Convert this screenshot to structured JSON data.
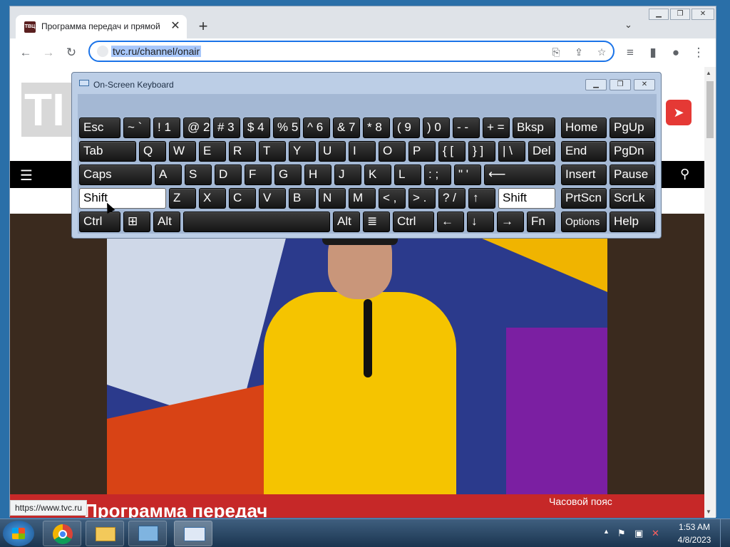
{
  "browser": {
    "tab_title": "Программа передач и прямой э",
    "tab_favicon_text": "ТВЦ",
    "new_tab": "+",
    "tab_search": "⌄",
    "url": "tvc.ru/channel/onair",
    "status_url": "https://www.tvc.ru"
  },
  "page": {
    "logo_text": "TI",
    "schedule_title": "Программа передач",
    "timezone_label": "Часовой пояс"
  },
  "osk": {
    "title": "On-Screen Keyboard",
    "keys": {
      "esc": "Esc",
      "tilde": "~ `",
      "n1": "! 1",
      "n2": "@ 2",
      "n3": "# 3",
      "n4": "$ 4",
      "n5": "% 5",
      "n6": "^ 6",
      "n7": "& 7",
      "n8": "* 8",
      "n9": "( 9",
      "n0": ") 0",
      "minus": "- -",
      "plus": "+ =",
      "bksp": "Bksp",
      "home": "Home",
      "pgup": "PgUp",
      "tab": "Tab",
      "q": "Q",
      "w": "W",
      "e": "E",
      "r": "R",
      "t": "T",
      "y": "Y",
      "u": "U",
      "i": "I",
      "o": "O",
      "p": "P",
      "lbrace": "{ [",
      "rbrace": "} ]",
      "pipe": "| \\",
      "del": "Del",
      "end": "End",
      "pgdn": "PgDn",
      "caps": "Caps",
      "a": "A",
      "s": "S",
      "d": "D",
      "f": "F",
      "g": "G",
      "h": "H",
      "j": "J",
      "k": "K",
      "l": "L",
      "colon": ": ;",
      "quote": "\" '",
      "enter": "⟵",
      "insert": "Insert",
      "pause": "Pause",
      "lshift": "Shift",
      "z": "Z",
      "x": "X",
      "c": "C",
      "v": "V",
      "b": "B",
      "n": "N",
      "m": "M",
      "lt": "< ,",
      "gt": "> .",
      "question": "? /",
      "up": "↑",
      "rshift": "Shift",
      "prtscn": "PrtScn",
      "scrlk": "ScrLk",
      "lctrl": "Ctrl",
      "win": "⊞",
      "lalt": "Alt",
      "ralt": "Alt",
      "menu": "≣",
      "rctrl": "Ctrl",
      "left": "←",
      "down": "↓",
      "right": "→",
      "fn": "Fn",
      "options": "Options",
      "help": "Help"
    }
  },
  "taskbar": {
    "time": "1:53 AM",
    "date": "4/8/2023"
  }
}
